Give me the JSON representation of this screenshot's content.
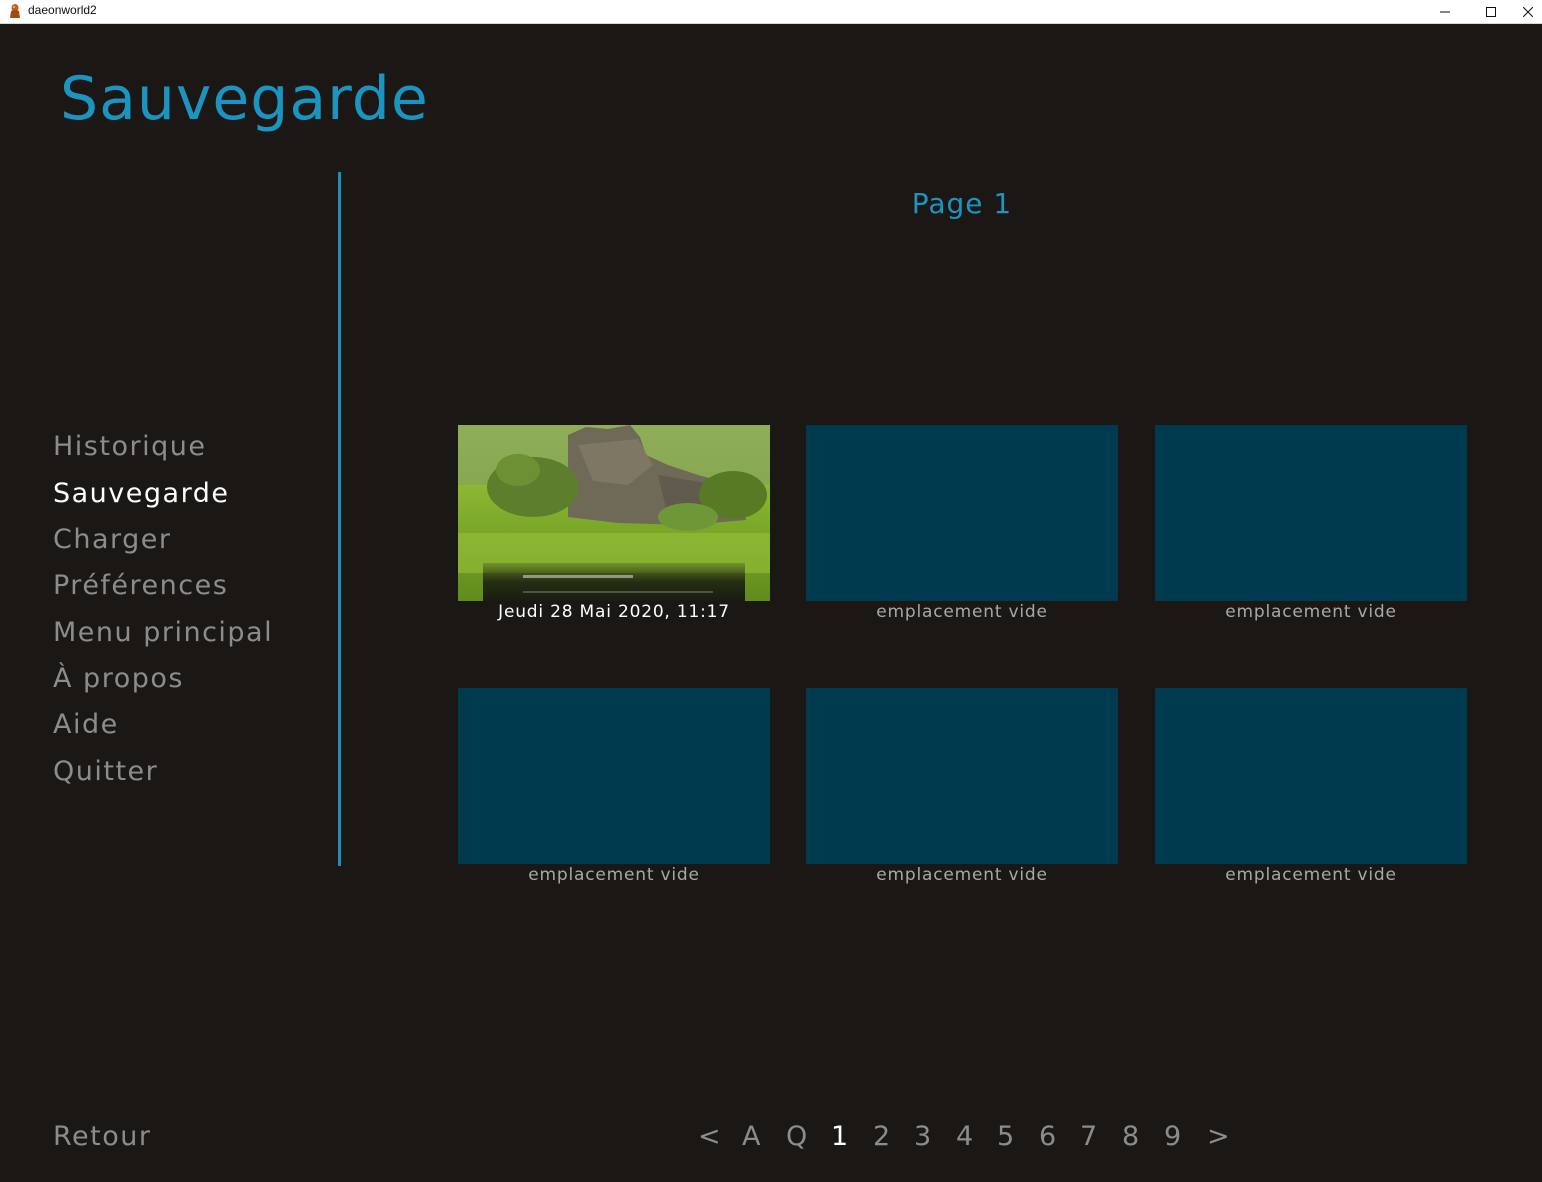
{
  "window": {
    "title": "daeonworld2"
  },
  "screen": {
    "title": "Sauvegarde",
    "page_label": "Page 1"
  },
  "nav": {
    "items": [
      {
        "label": "Historique",
        "active": false
      },
      {
        "label": "Sauvegarde",
        "active": true
      },
      {
        "label": "Charger",
        "active": false
      },
      {
        "label": "Préférences",
        "active": false
      },
      {
        "label": "Menu principal",
        "active": false
      },
      {
        "label": "À propos",
        "active": false
      },
      {
        "label": "Aide",
        "active": false
      },
      {
        "label": "Quitter",
        "active": false
      }
    ],
    "back_label": "Retour"
  },
  "slots": [
    {
      "caption": "Jeudi 28 Mai 2020, 11:17",
      "filled": true
    },
    {
      "caption": "emplacement vide",
      "filled": false
    },
    {
      "caption": "emplacement vide",
      "filled": false
    },
    {
      "caption": "emplacement vide",
      "filled": false
    },
    {
      "caption": "emplacement vide",
      "filled": false
    },
    {
      "caption": "emplacement vide",
      "filled": false
    }
  ],
  "pager": {
    "prev": "<",
    "auto": "A",
    "quick": "Q",
    "pages": [
      "1",
      "2",
      "3",
      "4",
      "5",
      "6",
      "7",
      "8",
      "9"
    ],
    "next": ">",
    "active_page": "1"
  },
  "colors": {
    "accent": "#1b94c0",
    "slot_empty": "#003a4e",
    "background": "#1a1715",
    "idle_text": "#8c8c8c",
    "selected_text": "#ffffff"
  }
}
